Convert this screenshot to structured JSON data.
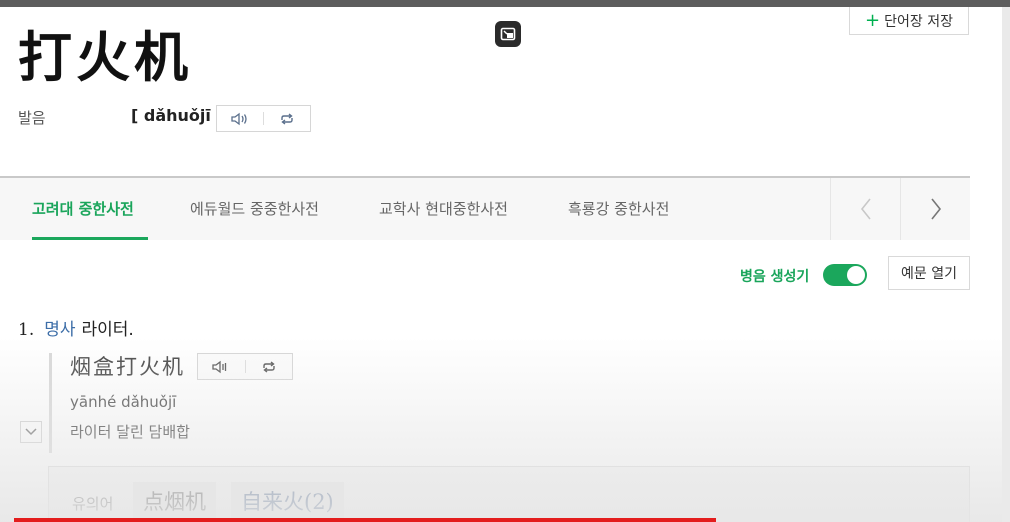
{
  "entry": {
    "headword": "打火机",
    "save_button": "단어장 저장",
    "pron_label": "발음",
    "pron_text": "[ dǎhuǒjī ]"
  },
  "tabs": [
    {
      "label": "고려대 중한사전",
      "active": true
    },
    {
      "label": "에듀월드 중중한사전",
      "active": false
    },
    {
      "label": "교학사 현대중한사전",
      "active": false
    },
    {
      "label": "흑룡강 중한사전",
      "active": false
    }
  ],
  "options": {
    "toggle_label": "병음 생성기",
    "toggle_on": true,
    "examples_button": "예문 열기"
  },
  "sense": {
    "number": "1.",
    "pos": "명사",
    "meaning": "라이터."
  },
  "example": {
    "hanzi": "烟盒打火机",
    "pinyin": "yānhé dǎhuǒjī",
    "meaning": "라이터 달린 담배합"
  },
  "synonyms": {
    "label": "유의어",
    "items": [
      "点烟机",
      "自来火(2)"
    ]
  },
  "colors": {
    "accent_green": "#1ba75c",
    "link_blue": "#3d6ea8",
    "progress_red": "#e31d1d"
  },
  "video_progress": 0.7
}
